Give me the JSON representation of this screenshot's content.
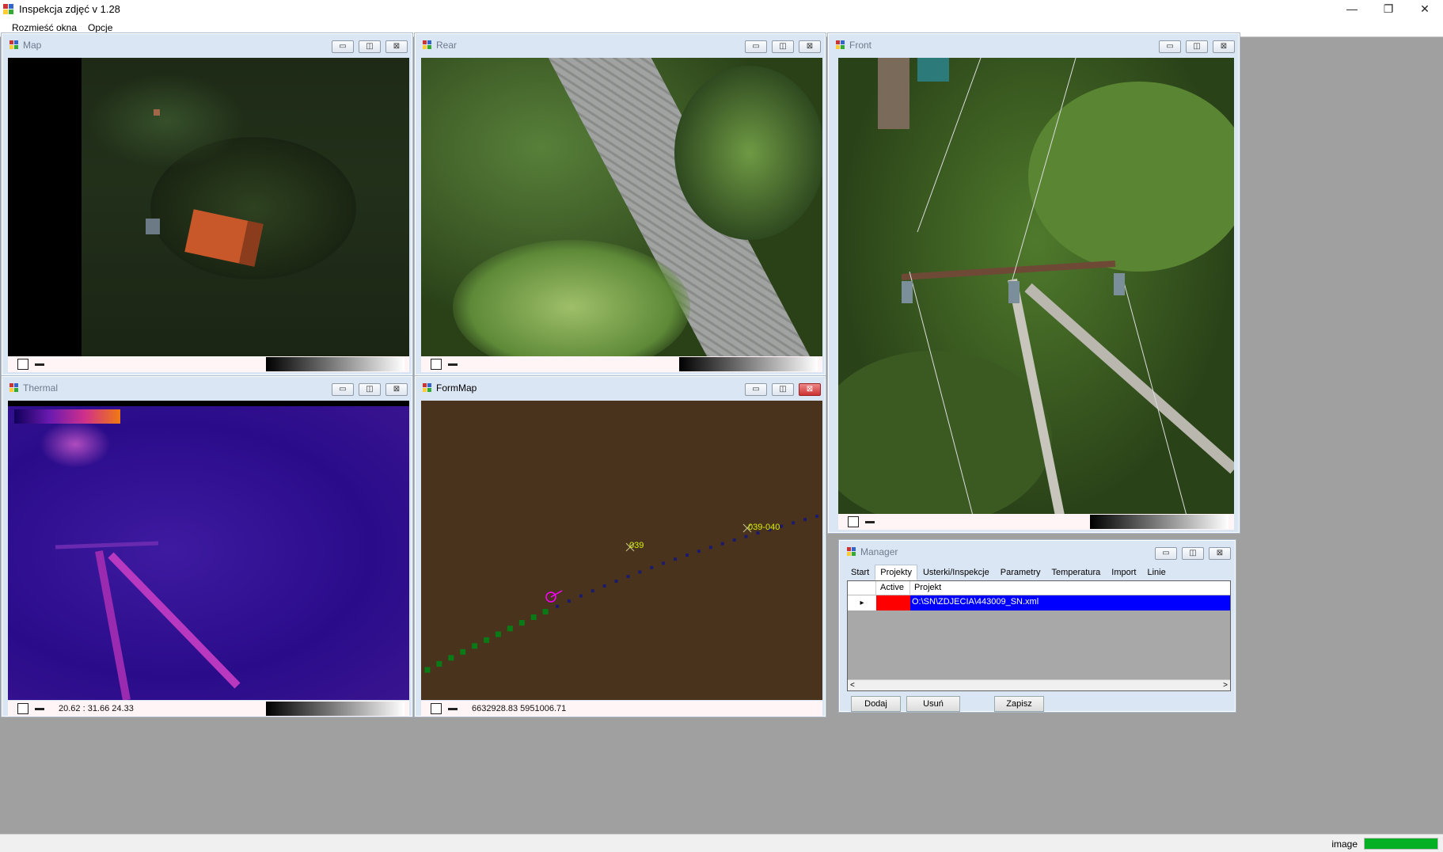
{
  "app": {
    "title": "Inspekcja zdjęć  v 1.28",
    "window_controls": {
      "minimize": "—",
      "restore": "❐",
      "close": "✕"
    }
  },
  "menu": [
    "Rozmieść okna",
    "Opcje"
  ],
  "child_controls": {
    "minimize": "▭",
    "maximize": "◫",
    "close": "⊠"
  },
  "windows": {
    "map": {
      "title": "Map"
    },
    "rear": {
      "title": "Rear"
    },
    "front": {
      "title": "Front"
    },
    "thermal": {
      "title": "Thermal",
      "footer_text": "20.62 : 31.66   24.33"
    },
    "formmap": {
      "title": "FormMap",
      "footer_text": "6632928.83 5951006.71",
      "labels": {
        "pole_1": "039",
        "pole_2": "039-040"
      },
      "background_color": "#4a331d"
    },
    "manager": {
      "title": "Manager",
      "tabs": [
        "Start",
        "Projekty",
        "Usterki/Inspekcje",
        "Parametry",
        "Temperatura",
        "Import",
        "Linie"
      ],
      "selected_tab": "Projekty",
      "grid": {
        "columns": [
          "Active",
          "Projekt"
        ],
        "rows": [
          {
            "active": "",
            "projekt": "O:\\SN\\ZDJECIA\\443009_SN.xml"
          }
        ],
        "row_marker": "▸",
        "scroll_left": "<",
        "scroll_right": ">"
      },
      "buttons": {
        "add": "Dodaj",
        "remove": "Usuń",
        "save": "Zapisz"
      }
    }
  },
  "status": {
    "label": "image",
    "progress_fraction": 1.0
  },
  "colors": {
    "active_cell": "#ff0000",
    "selected_row": "#0000ff",
    "progress": "#06b025",
    "caption_bg": "#dbe6f4"
  }
}
